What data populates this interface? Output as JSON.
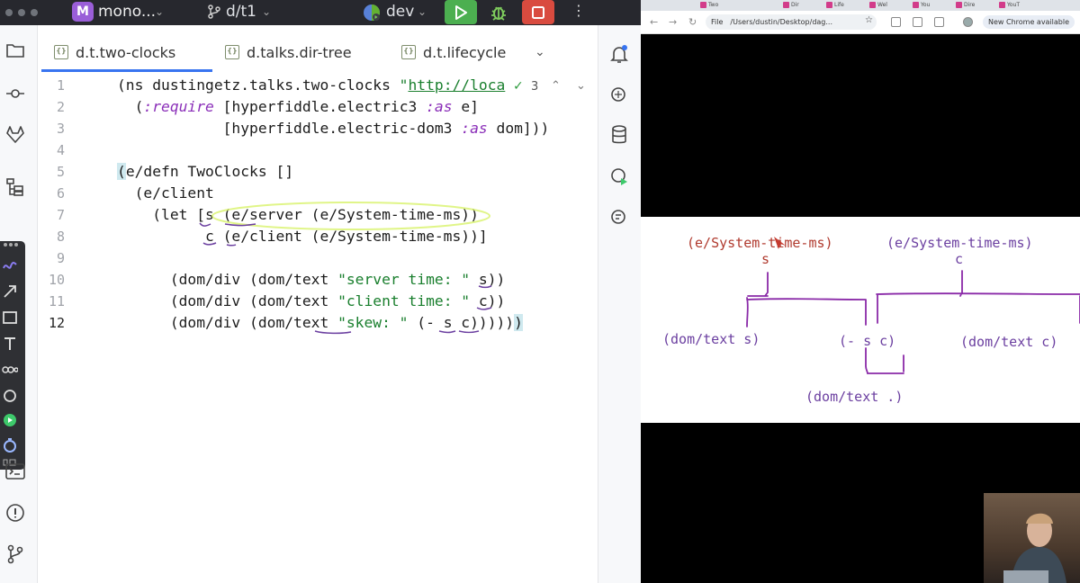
{
  "ide": {
    "project": {
      "badge": "M",
      "name": "mono..."
    },
    "branch": "d/t1",
    "run_config": "dev",
    "tabs": [
      {
        "label": "d.t.two-clocks"
      },
      {
        "label": "d.talks.dir-tree"
      },
      {
        "label": "d.t.lifecycle"
      }
    ],
    "inspections": {
      "count": "3"
    },
    "line_numbers": [
      "1",
      "2",
      "3",
      "4",
      "5",
      "6",
      "7",
      "8",
      "9",
      "10",
      "11",
      "12"
    ],
    "code_lines": {
      "l1": {
        "a": "(ns dustingetz.talks.two-clocks ",
        "b": "\"",
        "c": "http://loca"
      },
      "l2": {
        "a": "  (",
        "kw": ":require",
        "b": " [hyperfiddle.electric3 ",
        "kw2": ":as",
        "c": " e]"
      },
      "l3": {
        "a": "            [hyperfiddle.electric-dom3 ",
        "kw": ":as",
        "b": " dom]))"
      },
      "l4": "",
      "l5": {
        "a": "(",
        "b": "e/defn TwoClocks []"
      },
      "l6": "  (e/client",
      "l7": "    (let [s (e/server (e/System-time-ms))",
      "l8": "          c (e/client (e/System-time-ms))]",
      "l9": "",
      "l10": {
        "a": "      (dom/div (dom/text ",
        "s": "\"server time: \"",
        "b": " s))"
      },
      "l11": {
        "a": "      (dom/div (dom/text ",
        "s": "\"client time: \"",
        "b": " c))"
      },
      "l12": {
        "a": "      (dom/div (dom/text ",
        "s": "\"skew: \"",
        "b": " (- s c)))))",
        "c": ")"
      }
    }
  },
  "browser": {
    "tabs": [
      "Two",
      "Dir",
      "Life",
      "Wel",
      "You",
      "Dire",
      "YouT"
    ],
    "scheme": "File",
    "url": "/Users/dustin/Desktop/dag...",
    "update_label": "New Chrome available"
  },
  "diagram": {
    "server_clock": "(e/System-time-ms)",
    "server_var": "s",
    "client_clock": "(e/System-time-ms)",
    "client_var": "c",
    "node_text_s": "(dom/text s)",
    "node_skew": "(- s c)",
    "node_text_c": "(dom/text c)",
    "node_text_skew": "(dom/text .)"
  },
  "colors": {
    "server": "#b03a2e",
    "client": "#6b3fa0",
    "ide_bg": "#ffffff",
    "title_bar": "#27282e",
    "run": "#4caf50",
    "stop": "#d94b3f"
  }
}
